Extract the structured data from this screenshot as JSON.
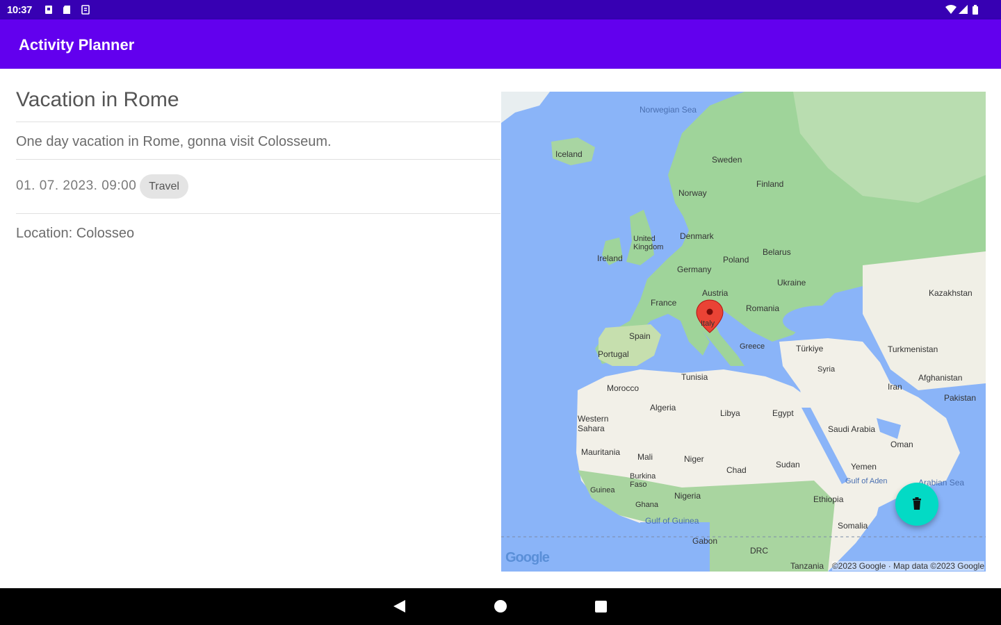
{
  "status_bar": {
    "time": "10:37"
  },
  "app_bar": {
    "title": "Activity Planner"
  },
  "activity": {
    "title": "Vacation in Rome",
    "description": "One day vacation in Rome, gonna visit Colosseum.",
    "datetime": "01. 07. 2023. 09:00",
    "category": "Travel",
    "location": "Location: Colosseo"
  },
  "map": {
    "labels": {
      "norwegian_sea": "Norwegian Sea",
      "iceland": "Iceland",
      "sweden": "Sweden",
      "finland": "Finland",
      "norway": "Norway",
      "united_kingdom": "United Kingdom",
      "denmark": "Denmark",
      "ireland": "Ireland",
      "belarus": "Belarus",
      "poland": "Poland",
      "germany": "Germany",
      "ukraine": "Ukraine",
      "austria": "Austria",
      "france": "France",
      "romania": "Romania",
      "italy": "Italy",
      "kazakhstan": "Kazakhstan",
      "spain": "Spain",
      "portugal": "Portugal",
      "greece": "Greece",
      "turkiye": "Türkiye",
      "turkmenistan": "Turkmenistan",
      "syria": "Syria",
      "tunisia": "Tunisia",
      "morocco": "Morocco",
      "afghanistan": "Afghanistan",
      "iran": "Iran",
      "pakistan": "Pakistan",
      "algeria": "Algeria",
      "libya": "Libya",
      "egypt": "Egypt",
      "western_sahara": "Western Sahara",
      "saudi_arabia": "Saudi Arabia",
      "oman": "Oman",
      "mauritania": "Mauritania",
      "mali": "Mali",
      "niger": "Niger",
      "chad": "Chad",
      "sudan": "Sudan",
      "yemen": "Yemen",
      "burkina_faso": "Burkina Faso",
      "gulf_of_aden": "Gulf of Aden",
      "arabian_sea": "Arabian Sea",
      "guinea": "Guinea",
      "nigeria": "Nigeria",
      "ethiopia": "Ethiopia",
      "ghana": "Ghana",
      "gulf_of_guinea": "Gulf of Guinea",
      "somalia": "Somalia",
      "gabon": "Gabon",
      "drc": "DRC",
      "tanzania": "Tanzania"
    },
    "google_logo": "Google",
    "attribution": "©2023 Google · Map data ©2023 Google",
    "marker_color": "#ea4335"
  },
  "fab": {
    "icon": "trash-icon",
    "color": "#03dac5"
  },
  "colors": {
    "primary": "#6200ee",
    "primary_dark": "#3700b3",
    "accent": "#03dac5"
  }
}
